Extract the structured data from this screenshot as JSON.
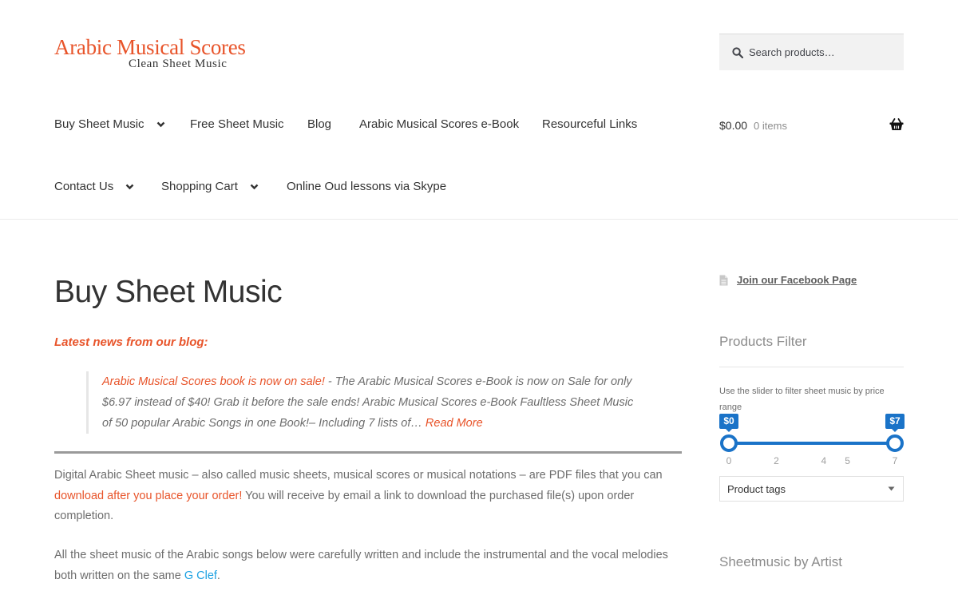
{
  "site": {
    "title": "Arabic Musical Scores",
    "subtitle": "Clean Sheet Music"
  },
  "search": {
    "placeholder": "Search products…",
    "icon": "search-icon"
  },
  "nav": {
    "buy_sheet_music": "Buy Sheet Music",
    "free_sheet_music": "Free Sheet Music",
    "blog": "Blog",
    "ebook": "Arabic Musical Scores e-Book",
    "resourceful_links": "Resourceful Links",
    "contact_us": "Contact Us",
    "shopping_cart": "Shopping Cart",
    "oud_lessons": "Online Oud lessons via Skype"
  },
  "cart": {
    "amount": "$0.00",
    "count": "0 items",
    "icon": "basket-icon"
  },
  "main": {
    "page_title": "Buy Sheet Music",
    "latest_heading": "Latest news from our blog:",
    "news": {
      "link": "Arabic Musical Scores book is now on sale!",
      "text": " - The Arabic Musical Scores e-Book is now on Sale for only $6.97 instead of $40! Grab it before the sale ends! Arabic Musical Scores e-Book Faultless Sheet Music of 50 popular Arabic Songs in one Book!– Including 7 lists of… ",
      "read_more": "Read More"
    },
    "paragraph1": {
      "before": "Digital Arabic Sheet music – also called music sheets, musical scores or musical notations – are PDF files that you can ",
      "link": "download after you place your order!",
      "after": " You will receive by email a link to download the purchased file(s) upon order completion."
    },
    "paragraph2": {
      "before": "All the sheet music of the Arabic songs below were carefully written and include the instrumental and the vocal melodies both written on the same ",
      "link": "G Clef",
      "after": "."
    }
  },
  "sidebar": {
    "facebook_link": "Join our Facebook Page",
    "facebook_icon": "document-icon",
    "products_filter_title": "Products Filter",
    "filter_hint": "Use the slider to filter sheet music by price range",
    "price_slider": {
      "min": 0,
      "max": 7,
      "selected_min": 0,
      "selected_max": 7,
      "min_label": "$0",
      "max_label": "$7",
      "ticks": [
        "0",
        "2",
        "4",
        "5",
        "7"
      ]
    },
    "product_tags": "Product tags",
    "sheetmusic_by_artist": "Sheetmusic by Artist"
  },
  "colors": {
    "brand_orange": "#e8542a",
    "slider_blue": "#1a73c8",
    "link_blue": "#1ba1e2",
    "text_gray": "#6d6d6d"
  }
}
